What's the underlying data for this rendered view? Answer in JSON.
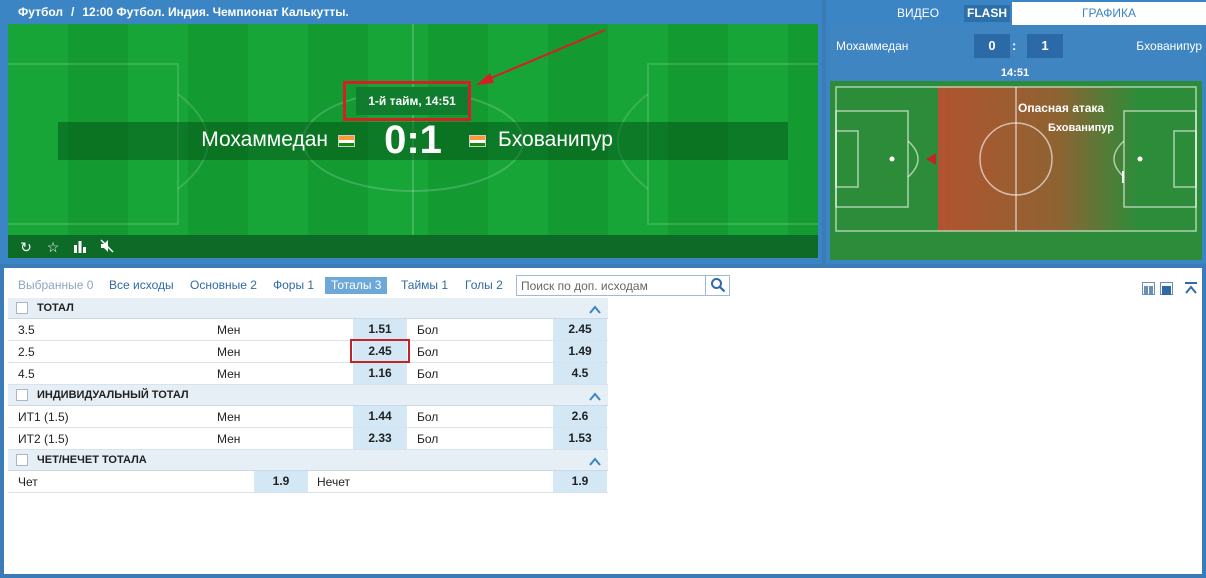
{
  "breadcrumb": {
    "sport": "Футбол",
    "separator": "/",
    "event": "12:00 Футбол. Индия. Чемпионат Калькутты."
  },
  "video": {
    "half_label": "1-й тайм, 14:51",
    "home_team": "Мохаммедан",
    "away_team": "Бхованипур",
    "score": "0:1",
    "controls": [
      "refresh-icon",
      "star-icon",
      "stats-icon",
      "mute-icon"
    ],
    "colors": {
      "field": "#16a536",
      "highlight": "#d41f26"
    }
  },
  "tracker": {
    "tabs": [
      {
        "label": "ВИДЕО",
        "active": false
      },
      {
        "label": "FLASH",
        "active": false
      },
      {
        "label": "ГРАФИКА",
        "active": true
      }
    ],
    "home_team": "Мохаммедан",
    "away_team": "Бхованипур",
    "home_score": "0",
    "away_score": "1",
    "score_separator": ":",
    "time": "14:51",
    "event_title": "Опасная атака",
    "event_team": "Бхованипур"
  },
  "filters": {
    "selected": "Выбранные 0",
    "all": "Все исходы",
    "main": "Основные 2",
    "handicaps": "Форы 1",
    "totals": "Тоталы 3",
    "halves": "Таймы 1",
    "goals": "Голы 2",
    "search_placeholder": "Поиск по доп. исходам"
  },
  "markets": {
    "total": {
      "title": "ТОТАЛ",
      "rows": [
        {
          "line": "3.5",
          "under_label": "Мен",
          "under": "1.51",
          "over_label": "Бол",
          "over": "2.45"
        },
        {
          "line": "2.5",
          "under_label": "Мен",
          "under": "2.45",
          "over_label": "Бол",
          "over": "1.49"
        },
        {
          "line": "4.5",
          "under_label": "Мен",
          "under": "1.16",
          "over_label": "Бол",
          "over": "4.5"
        }
      ]
    },
    "individual_total": {
      "title": "ИНДИВИДУАЛЬНЫЙ ТОТАЛ",
      "rows": [
        {
          "line": "ИТ1 (1.5)",
          "under_label": "Мен",
          "under": "1.44",
          "over_label": "Бол",
          "over": "2.6"
        },
        {
          "line": "ИТ2 (1.5)",
          "under_label": "Мен",
          "under": "2.33",
          "over_label": "Бол",
          "over": "1.53"
        }
      ]
    },
    "odd_even": {
      "title": "ЧЕТ/НЕЧЕТ ТОТАЛА",
      "even_label": "Чет",
      "even": "1.9",
      "odd_label": "Нечет",
      "odd": "1.9"
    }
  }
}
